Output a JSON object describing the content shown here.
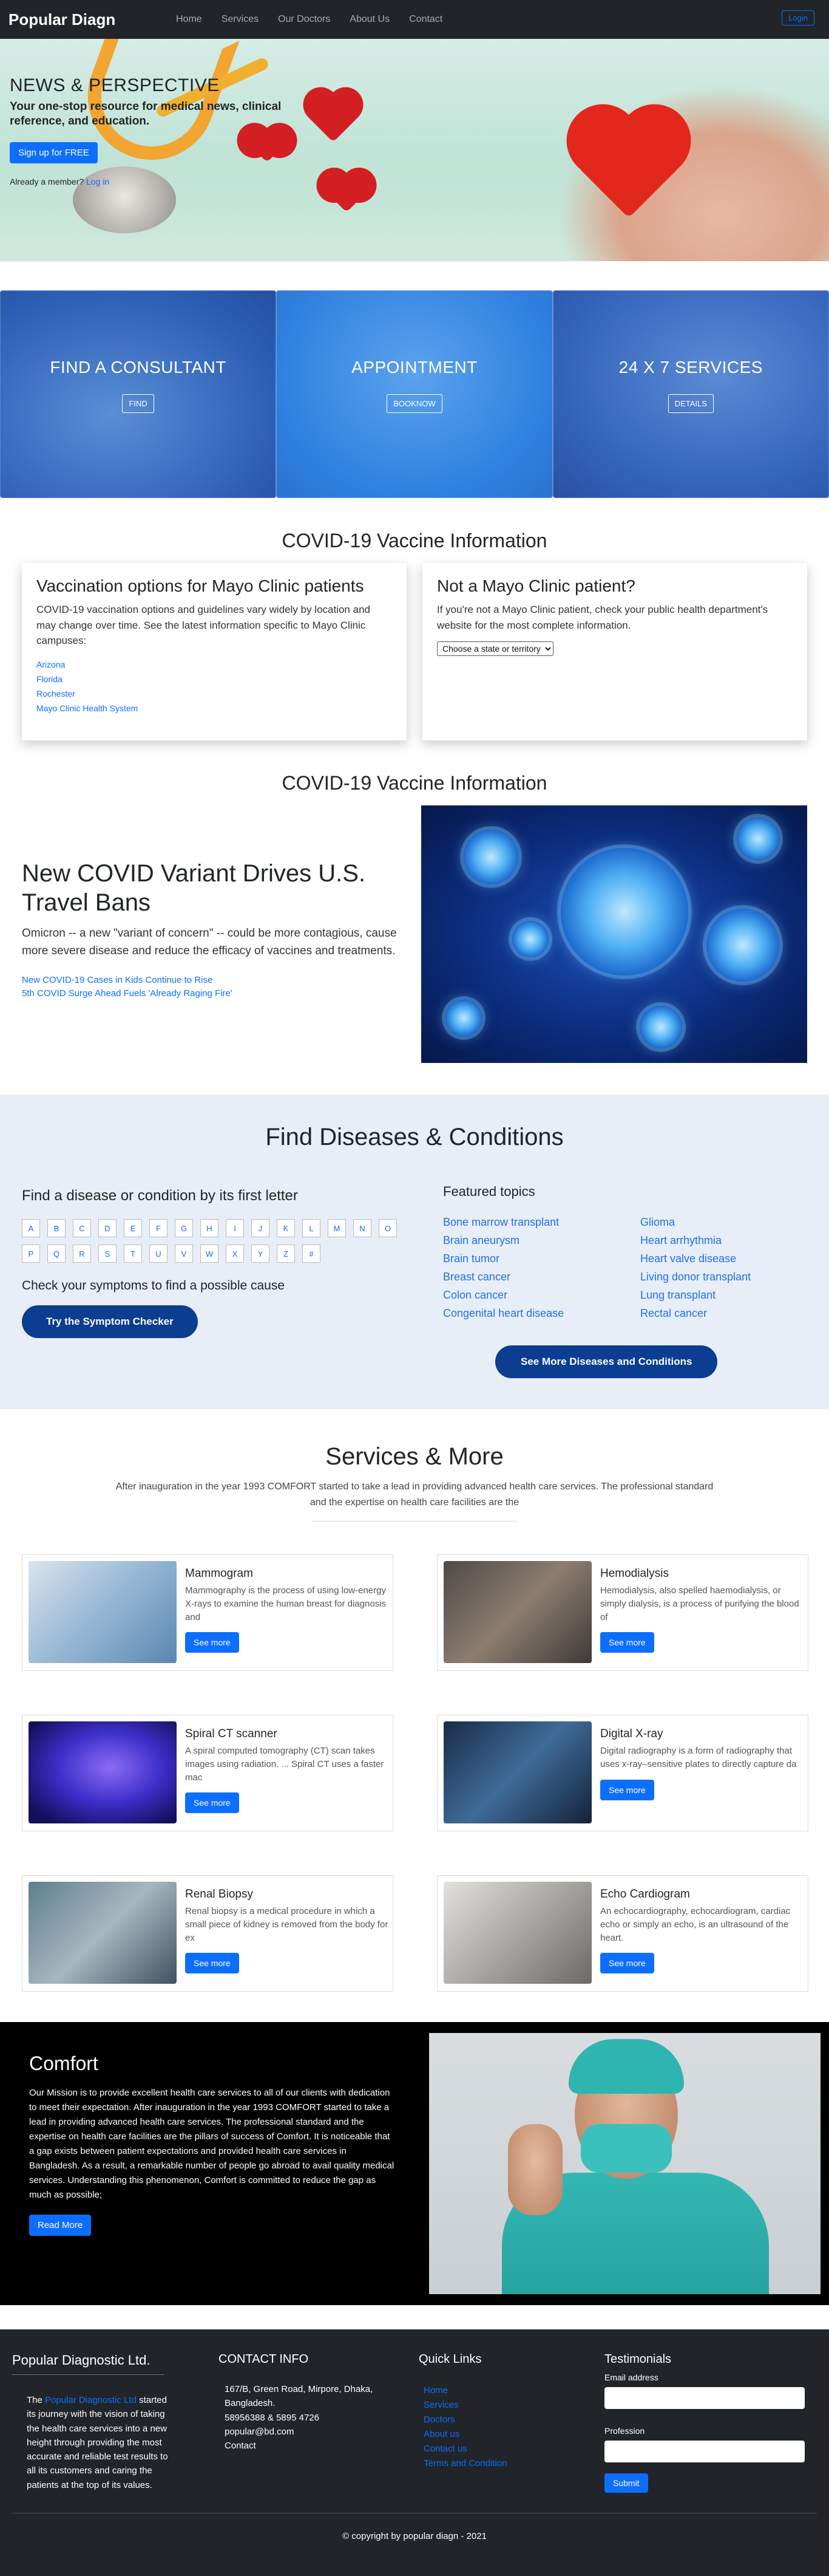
{
  "nav": {
    "brand": "Popular Diagn",
    "links": [
      "Home",
      "Services",
      "Our Doctors",
      "About Us",
      "Contact"
    ],
    "login": "Login"
  },
  "hero": {
    "title": "NEWS & PERSPECTIVE",
    "subtitle": "Your one-stop resource for medical news, clinical reference, and education.",
    "signup": "Sign up for FREE",
    "member_text": "Already a member?",
    "member_link": "Log in"
  },
  "tiles": [
    {
      "title": "FIND A CONSULTANT",
      "button": "FIND"
    },
    {
      "title": "APPOINTMENT",
      "button": "BOOKNOW"
    },
    {
      "title": "24 X 7 SERVICES",
      "button": "DETAILS"
    }
  ],
  "covid_info": {
    "heading": "COVID-19 Vaccine Information",
    "card_a": {
      "title": "Vaccination options for Mayo Clinic patients",
      "text": "COVID-19 vaccination options and guidelines vary widely by location and may change over time. See the latest information specific to Mayo Clinic campuses:",
      "links": [
        "Arizona",
        "Florida",
        "Rochester",
        "Mayo Clinic Health System"
      ]
    },
    "card_b": {
      "title": "Not a Mayo Clinic patient?",
      "text": "If you're not a Mayo Clinic patient, check your public health department's website for the most complete information.",
      "select": "Choose a state or territory"
    }
  },
  "covid_news": {
    "heading": "COVID-19 Vaccine Information",
    "title": "New COVID Variant Drives U.S. Travel Bans",
    "text": "Omicron -- a new \"variant of concern\" -- could be more contagious, cause more severe disease and reduce the efficacy of vaccines and treatments.",
    "links": [
      "New COVID-19 Cases in Kids Continue to Rise",
      "5th COVID Surge Ahead Fuels 'Already Raging Fire'"
    ]
  },
  "diseases": {
    "heading": "Find Diseases & Conditions",
    "letter_heading": "Find a disease or condition by its first letter",
    "letters": [
      "A",
      "B",
      "C",
      "D",
      "E",
      "F",
      "G",
      "H",
      "I",
      "J",
      "K",
      "L",
      "M",
      "N",
      "O",
      "P",
      "Q",
      "R",
      "S",
      "T",
      "U",
      "V",
      "W",
      "X",
      "Y",
      "Z",
      "#"
    ],
    "symptom_heading": "Check your symptoms to find a possible cause",
    "symptom_button": "Try the Symptom Checker",
    "featured_heading": "Featured topics",
    "topics": [
      "Bone marrow transplant",
      "Glioma",
      "Brain aneurysm",
      "Heart arrhythmia",
      "Brain tumor",
      "Heart valve disease",
      "Breast cancer",
      "Living donor transplant",
      "Colon cancer",
      "Lung transplant",
      "Congenital heart disease",
      "Rectal cancer"
    ],
    "more_button": "See More Diseases and Conditions"
  },
  "services": {
    "heading": "Services & More",
    "intro": "After inauguration in the year 1993 COMFORT started to take a lead in providing advanced health care services. The professional standard and the expertise on health care facilities are the",
    "button": "See more",
    "items": [
      {
        "title": "Mammogram",
        "text": "Mammography is the process of using low-energy X-rays to examine the human breast for diagnosis and"
      },
      {
        "title": "Hemodialysis",
        "text": "Hemodialysis, also spelled haemodialysis, or simply dialysis, is a process of purifying the blood of"
      },
      {
        "title": "Spiral CT scanner",
        "text": "A spiral computed tomography (CT) scan takes images using radiation. ... Spiral CT uses a faster mac"
      },
      {
        "title": "Digital X-ray",
        "text": "Digital radiography is a form of radiography that uses x-ray–sensitive plates to directly capture da"
      },
      {
        "title": "Renal Biopsy",
        "text": "Renal biopsy is a medical procedure in which a small piece of kidney is removed from the body for ex"
      },
      {
        "title": "Echo Cardiogram",
        "text": "An echocardiography, echocardiogram, cardiac echo or simply an echo, is an ultrasound of the heart."
      }
    ]
  },
  "comfort": {
    "title": "Comfort",
    "text": "Our Mission is to provide excellent health care services to all of our clients with dedication to meet their expectation. After inauguration in the year 1993 COMFORT started to take a lead in providing advanced health care services. The professional standard and the expertise on health care facilities are the pillars of success of Comfort. It is noticeable that a gap exists between patient expectations and provided health care services in Bangladesh. As a result, a remarkable number of people go abroad to avail quality medical services. Understanding this phenomenon, Comfort is committed to reduce the gap as much as possible;",
    "button": "Read More"
  },
  "footer": {
    "company": "Popular Diagnostic Ltd.",
    "about_pre": "The ",
    "about_link": "Popular Diagnostic Ltd",
    "about_post": " started its journey with the vision of taking the health care services into a new height through providing the most accurate and reliable test results to all its customers and caring the patients at the top of its values.",
    "contact_heading": "CONTACT INFO",
    "address": "167/B, Green Road, Mirpore, Dhaka, Bangladesh.",
    "phone": "58956388 & 5895 4726",
    "email": "popular@bd.com",
    "contact": "Contact",
    "quick_heading": "Quick Links",
    "quick_links": [
      "Home",
      "Services",
      "Doctors",
      "About us",
      "Contact us",
      "Terms and Condition"
    ],
    "testimonials_heading": "Testimonials",
    "email_label": "Email address",
    "profession_label": "Profession",
    "submit": "Submit",
    "copyright": "© copyright by popular diagn - 2021"
  }
}
